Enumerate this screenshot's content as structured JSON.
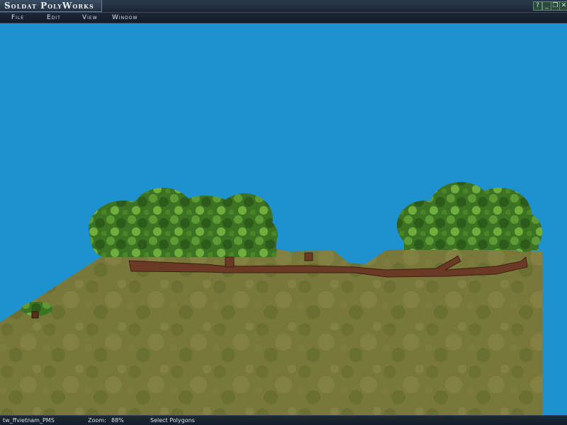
{
  "window": {
    "title": "Soldat PolyWorks",
    "buttons": {
      "help": "?",
      "minimize": "_",
      "maximize": "❐",
      "close": "✕"
    }
  },
  "menu": {
    "file": "File",
    "edit": "Edit",
    "view": "View",
    "window": "Window"
  },
  "status": {
    "filename": "tw_ffvietnam_PMS",
    "zoom_label": "Zoom:",
    "zoom_value": "88%",
    "mode": "Select Polygons"
  },
  "colors": {
    "sky": "#1e92cf",
    "grass": "#7a7c3a",
    "trench": "#6b3c25",
    "foliage": "#3f7a23"
  }
}
